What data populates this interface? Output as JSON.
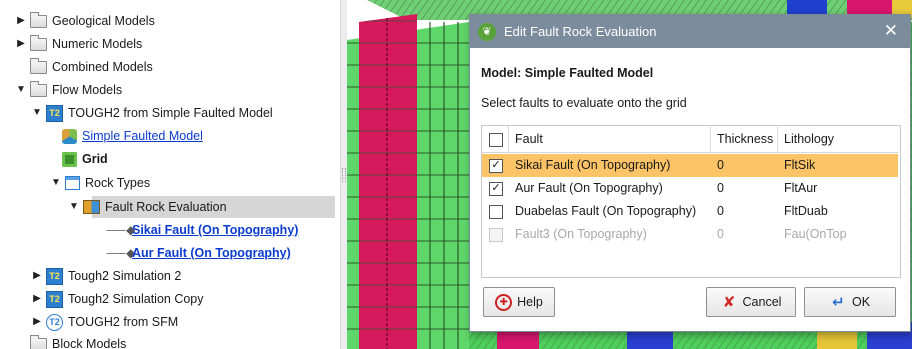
{
  "tree": {
    "items": [
      {
        "label": "Geological Models",
        "expand": "▶"
      },
      {
        "label": "Numeric Models",
        "expand": "▶"
      },
      {
        "label": "Combined Models",
        "expand": ""
      },
      {
        "label": "Flow Models",
        "expand": "▼"
      },
      {
        "label": "TOUGH2 from Simple Faulted Model",
        "expand": "▼"
      },
      {
        "label": "Simple Faulted Model",
        "expand": ""
      },
      {
        "label": "Grid",
        "expand": ""
      },
      {
        "label": "Rock Types",
        "expand": "▼"
      },
      {
        "label": "Fault Rock Evaluation",
        "expand": "▼"
      },
      {
        "label": "Sikai Fault (On Topography)",
        "expand": ""
      },
      {
        "label": "Aur Fault (On Topography)",
        "expand": ""
      },
      {
        "label": "Tough2 Simulation 2",
        "expand": "▶"
      },
      {
        "label": "Tough2 Simulation Copy",
        "expand": "▶"
      },
      {
        "label": "TOUGH2 from SFM",
        "expand": "▶"
      },
      {
        "label": "Block Models",
        "expand": ""
      }
    ],
    "icon_glyphs": {
      "tough2": "T2"
    }
  },
  "dialog": {
    "title": "Edit Fault Rock Evaluation",
    "close_glyph": "✕",
    "model_label": "Model: Simple Faulted Model",
    "instruction": "Select faults to evaluate onto the grid",
    "columns": [
      "Fault",
      "Thickness",
      "Lithology"
    ],
    "rows": [
      {
        "fault": "Sikai Fault (On Topography)",
        "thickness": "0",
        "lithology": "FltSik",
        "checked": "✓",
        "selected": true,
        "enabled": true
      },
      {
        "fault": "Aur Fault (On Topography)",
        "thickness": "0",
        "lithology": "FltAur",
        "checked": "✓",
        "selected": false,
        "enabled": true
      },
      {
        "fault": "Duabelas Fault (On Topography)",
        "thickness": "0",
        "lithology": "FltDuab",
        "checked": "",
        "selected": false,
        "enabled": true
      },
      {
        "fault": "Fault3 (On Topography)",
        "thickness": "0",
        "lithology": "Fau(OnTop",
        "checked": "",
        "selected": false,
        "enabled": false
      }
    ],
    "buttons": {
      "help": "Help",
      "cancel": "Cancel",
      "ok": "OK"
    }
  },
  "colors": {
    "selection": "#fcc466",
    "title_bar": "#7b8c9c",
    "link": "#0b3ccf",
    "scene_green": "#5fd66a",
    "scene_magenta": "#d6195a"
  }
}
